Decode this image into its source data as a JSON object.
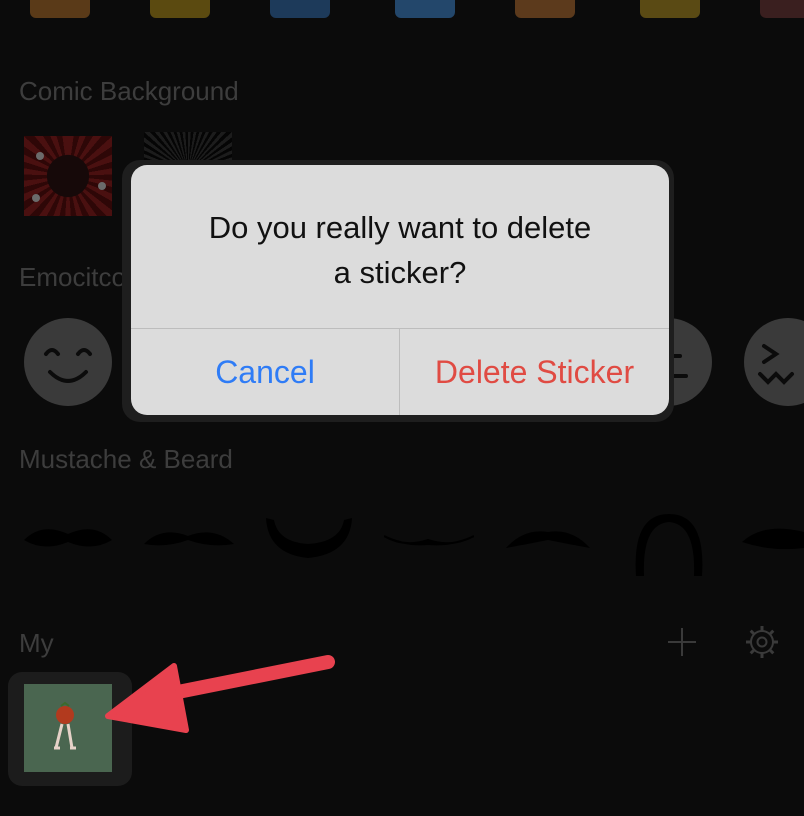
{
  "sections": {
    "comic_background": "Comic Background",
    "emoticon": "Emocitco",
    "mustache_beard": "Mustache & Beard",
    "my": "My"
  },
  "dialog": {
    "message": "Do you really want to delete a sticker?",
    "cancel_label": "Cancel",
    "delete_label": "Delete Sticker"
  },
  "colors": {
    "background": "#0b0b0b",
    "dim_text": "#3d3d3d",
    "dialog_bg": "#dcdcdc",
    "cancel_blue": "#2f7cf6",
    "delete_red": "#e04b43",
    "annotation_arrow": "#e8424f"
  },
  "icons": {
    "add": "plus-icon",
    "settings": "gear-icon",
    "annotation": "arrow-icon"
  }
}
